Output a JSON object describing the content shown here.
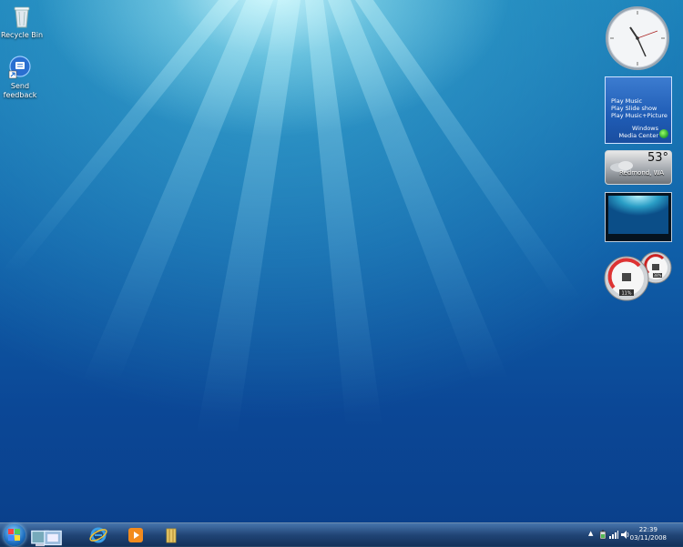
{
  "desktop": {
    "icons": [
      {
        "label": "Recycle Bin",
        "icon": "recycle-bin-icon"
      },
      {
        "label_line1": "Send",
        "label_line2": "feedback",
        "icon": "send-feedback-icon"
      }
    ]
  },
  "gadgets": {
    "media_center": {
      "items": [
        "Play Music",
        "Play Slide show",
        "Play Music+Picture"
      ],
      "brand_line1": "Windows",
      "brand_line2": "Media Center"
    },
    "weather": {
      "temperature": "53°",
      "location": "Redmond, WA"
    },
    "cpu_meter": {
      "cpu": "11%",
      "memory": "38%"
    }
  },
  "taskbar": {
    "pinned": [
      "internet-explorer-icon",
      "media-player-icon",
      "explorer-folder-icon"
    ],
    "clock": {
      "time": "22:39",
      "date": "03/11/2008"
    }
  }
}
